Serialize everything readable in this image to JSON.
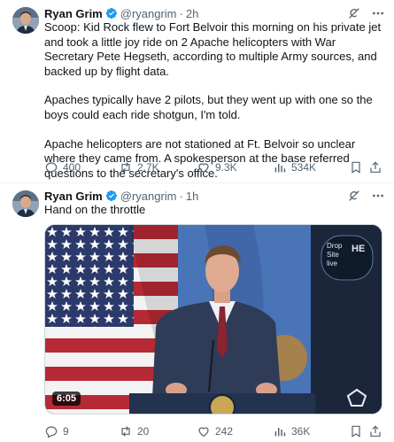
{
  "tweets": [
    {
      "author_name": "Ryan Grim",
      "handle": "@ryangrim",
      "separator": "·",
      "time": "2h",
      "paragraphs": [
        "Scoop: Kid Rock flew to Fort Belvoir this morning on his private jet and took a little joy ride on 2 Apache helicopters with War Secretary Pete Hegseth, according to multiple Army sources, and backed up by flight data.",
        "Apaches typically have 2 pilots, but they went up with one so the boys could each ride shotgun, I'm told.",
        "Apache helicopters are not stationed at Ft. Belvoir so unclear where they came from. A spokesperson at the base referred questions to the secretary's office."
      ],
      "replies": "400",
      "reposts": "2.7K",
      "likes": "9.3K",
      "views": "534K"
    },
    {
      "author_name": "Ryan Grim",
      "handle": "@ryangrim",
      "separator": "·",
      "time": "1h",
      "paragraphs": [
        "Hand on the throttle"
      ],
      "media": {
        "duration": "6:05",
        "screen_text_line1": "Drop",
        "screen_text_line2": "Site",
        "screen_text_line3": "live",
        "screen_text_right": "HE"
      },
      "replies": "9",
      "reposts": "20",
      "likes": "242",
      "views": "36K"
    }
  ],
  "colors": {
    "text": "#0f1419",
    "muted": "#536471",
    "verified": "#1d9bf0",
    "divider": "#eff3f4"
  },
  "icons": [
    "verified-badge-icon",
    "grok-icon",
    "more-icon",
    "reply-icon",
    "repost-icon",
    "like-icon",
    "views-icon",
    "bookmark-icon",
    "share-icon"
  ]
}
